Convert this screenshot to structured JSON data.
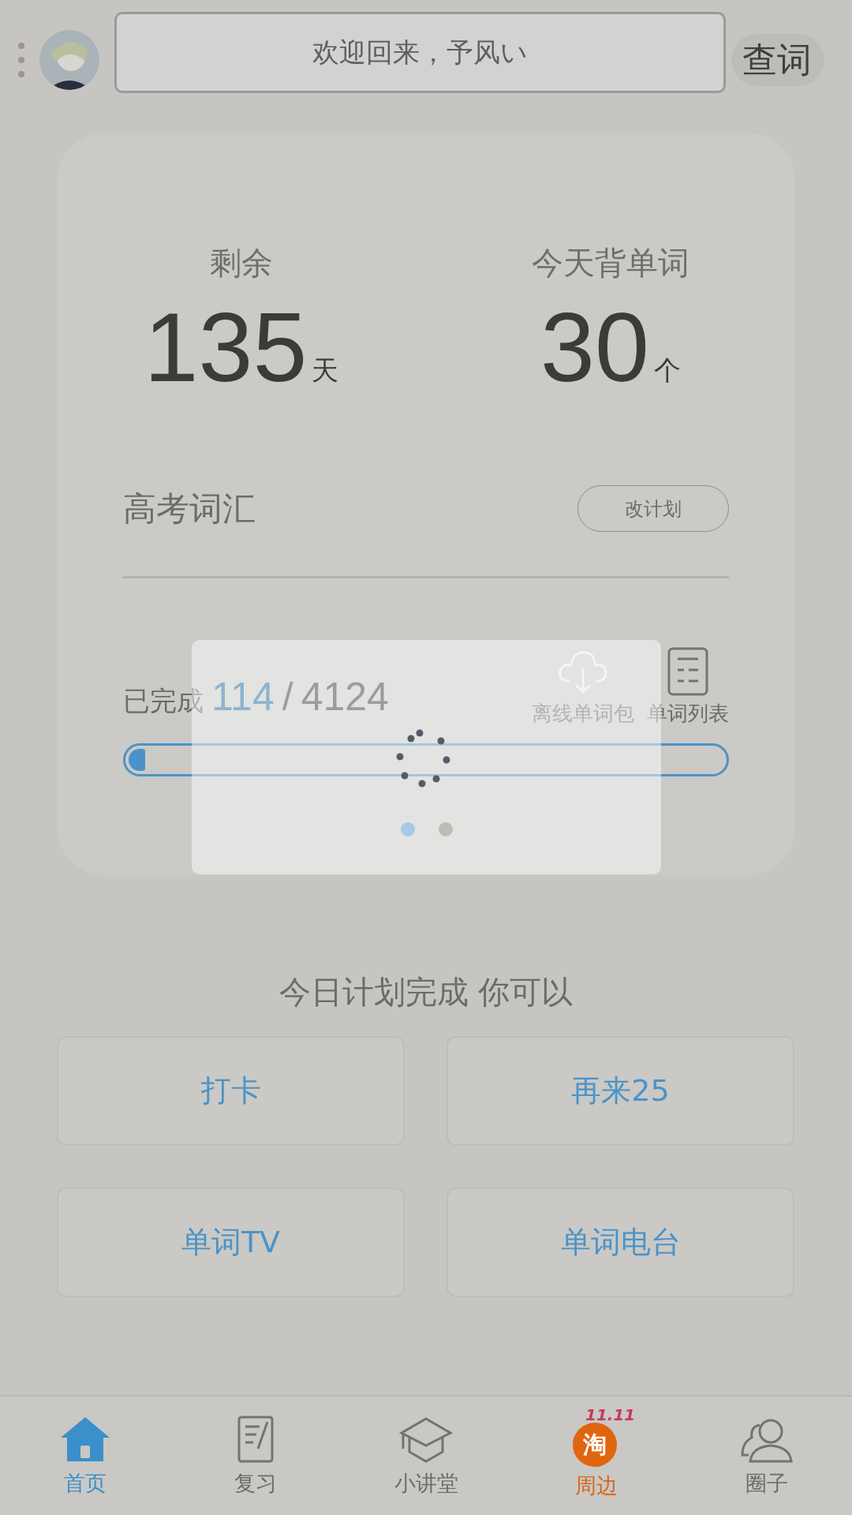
{
  "header": {
    "lookup_button": "查词"
  },
  "toast": {
    "text": "欢迎回来，予风い"
  },
  "plan": {
    "stats": [
      {
        "label": "剩余",
        "value": "135",
        "unit": "天"
      },
      {
        "label": "今天背单词",
        "value": "30",
        "unit": "个"
      }
    ],
    "book": "高考词汇",
    "change_button": "改计划",
    "progress": {
      "label": "已完成",
      "done": "114",
      "separator": "/",
      "total": "4124",
      "level": 0.028
    },
    "tools": [
      {
        "kind": "cloud",
        "label": "离线单词包"
      },
      {
        "kind": "list",
        "label": "单词列表"
      }
    ]
  },
  "loading": {
    "pages": [
      {
        "selected": true
      },
      {
        "selected": false
      }
    ]
  },
  "done_title": "今日计划完成 你可以",
  "actions": [
    "打卡",
    "再来25",
    "单词TV",
    "单词电台"
  ],
  "nav": [
    {
      "label": "首页",
      "selected": true,
      "kind": "home"
    },
    {
      "label": "复习",
      "selected": false,
      "kind": "review"
    },
    {
      "label": "小讲堂",
      "selected": false,
      "kind": "class"
    },
    {
      "label": "周边",
      "selected": false,
      "kind": "promo",
      "icon_text": "淘",
      "badge": "11.11"
    },
    {
      "label": "圈子",
      "selected": false,
      "kind": "people"
    }
  ]
}
